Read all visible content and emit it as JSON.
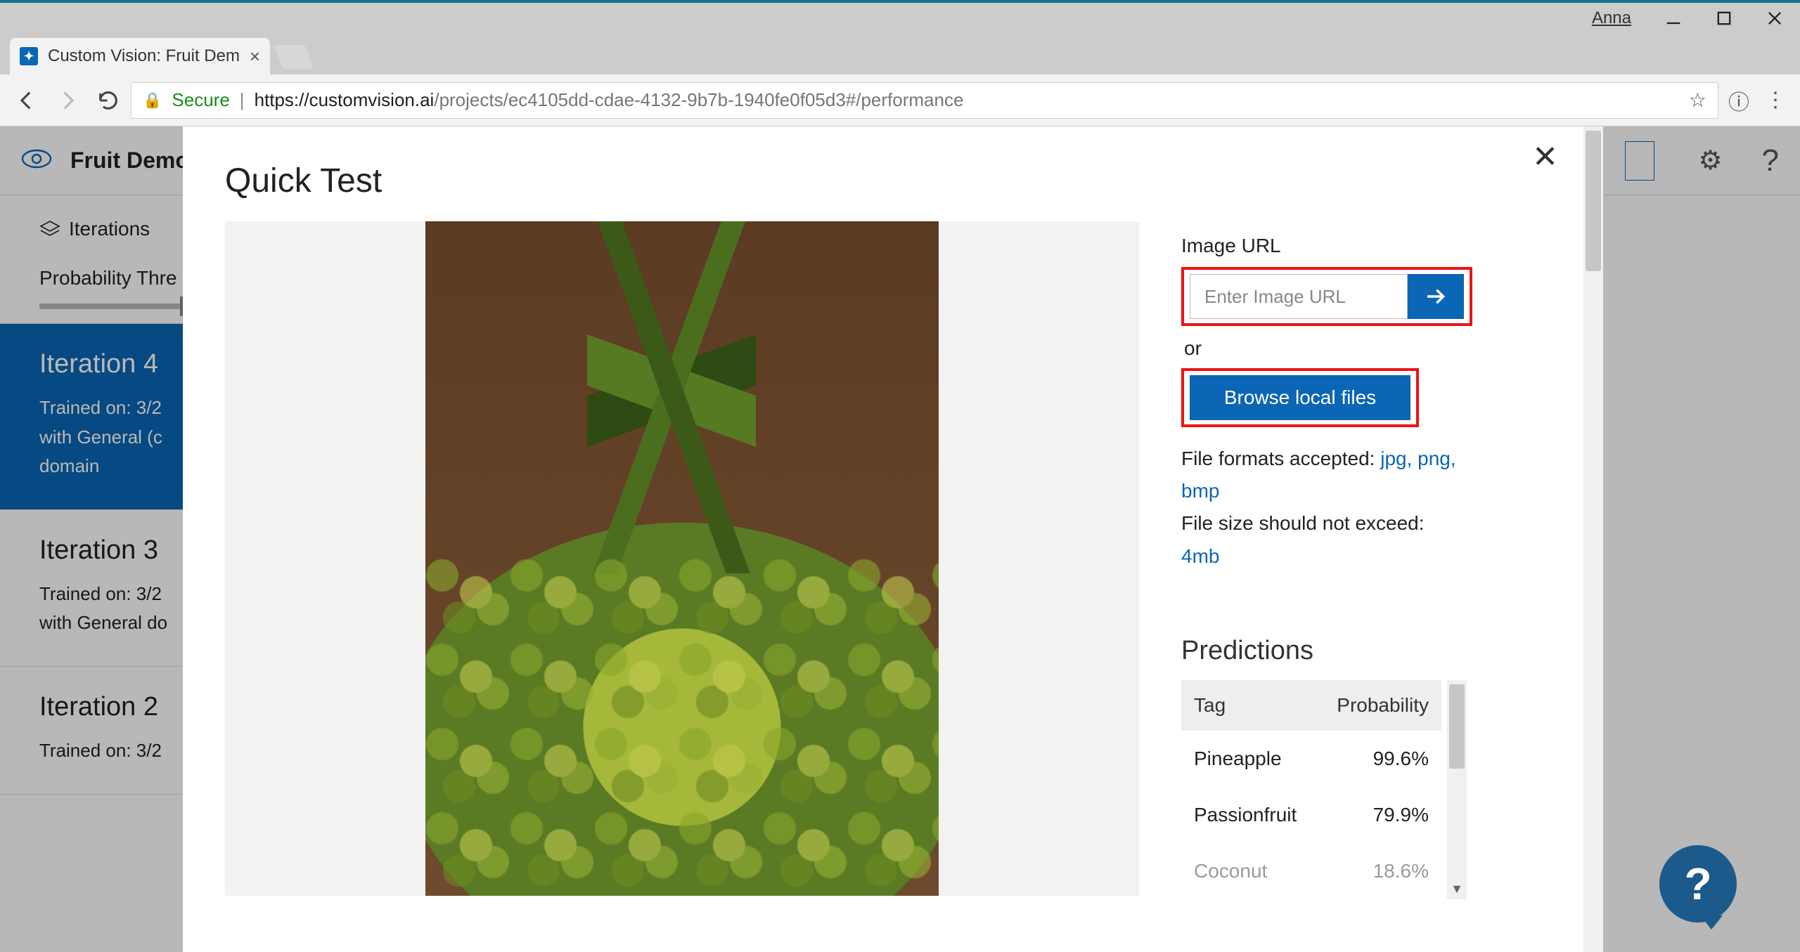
{
  "window": {
    "user": "Anna"
  },
  "browser": {
    "tab_title": "Custom Vision: Fruit Dem",
    "secure_label": "Secure",
    "url_host": "https://customvision.ai",
    "url_path": "/projects/ec4105dd-cdae-4132-9b7b-1940fe0f05d3#/performance"
  },
  "app": {
    "project_title": "Fruit Demo",
    "iterations_label": "Iterations",
    "prob_threshold_label": "Probability Thre",
    "iterations": [
      {
        "title": "Iteration 4",
        "line1": "Trained on: 3/2",
        "line2": "with General (c",
        "line3": "domain"
      },
      {
        "title": "Iteration 3",
        "line1": "Trained on: 3/2",
        "line2": "with General do",
        "line3": ""
      },
      {
        "title": "Iteration 2",
        "line1": "Trained on: 3/2",
        "line2": "",
        "line3": ""
      }
    ]
  },
  "modal": {
    "title": "Quick Test",
    "image_url_label": "Image URL",
    "url_placeholder": "Enter Image URL",
    "or_label": "or",
    "browse_label": "Browse local files",
    "formats_prefix": "File formats accepted: ",
    "formats_list": "jpg, png, bmp",
    "size_prefix": "File size should not exceed: ",
    "size_limit": "4mb",
    "predictions_heading": "Predictions",
    "col_tag": "Tag",
    "col_prob": "Probability",
    "rows": [
      {
        "tag": "Pineapple",
        "prob": "99.6%"
      },
      {
        "tag": "Passionfruit",
        "prob": "79.9%"
      },
      {
        "tag": "Coconut",
        "prob": "18.6%"
      }
    ]
  },
  "help_bubble": "?"
}
